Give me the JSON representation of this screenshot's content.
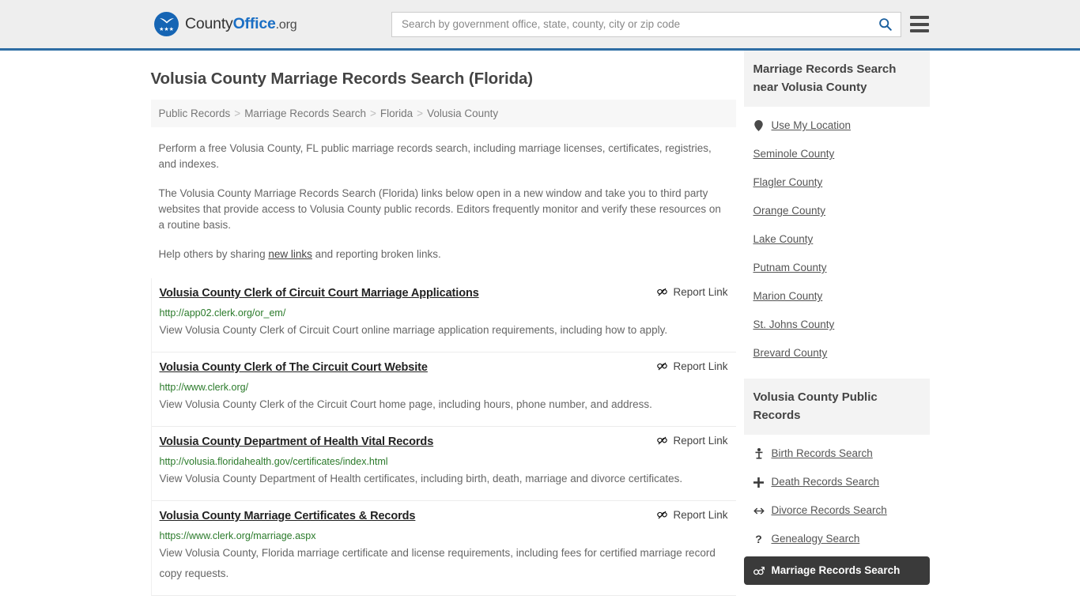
{
  "header": {
    "logo": {
      "text_county": "County",
      "text_office": "Office",
      "text_org": ".org",
      "stars": "★★★",
      "icon": "eagle-shield-logo"
    },
    "search": {
      "placeholder": "Search by government office, state, county, city or zip code",
      "value": "",
      "search_icon": "search-icon"
    },
    "menu_icon": "hamburger-menu-icon"
  },
  "page": {
    "title": "Volusia County Marriage Records Search (Florida)"
  },
  "breadcrumb": {
    "separator": ">",
    "items": [
      {
        "label": "Public Records"
      },
      {
        "label": "Marriage Records Search"
      },
      {
        "label": "Florida"
      },
      {
        "label": "Volusia County"
      }
    ]
  },
  "intro": {
    "paragraph1": "Perform a free Volusia County, FL public marriage records search, including marriage licenses, certificates, registries, and indexes.",
    "paragraph2": "The Volusia County Marriage Records Search (Florida) links below open in a new window and take you to third party websites that provide access to Volusia County public records. Editors frequently monitor and verify these resources on a routine basis.",
    "paragraph3_before": "Help others by sharing ",
    "paragraph3_link": "new links",
    "paragraph3_after": " and reporting broken links."
  },
  "report_link": {
    "label": "Report Link",
    "icon": "broken-link-icon"
  },
  "results": [
    {
      "title": "Volusia County Clerk of Circuit Court Marriage Applications",
      "url": "http://app02.clerk.org/or_em/",
      "description": "View Volusia County Clerk of Circuit Court online marriage application requirements, including how to apply."
    },
    {
      "title": "Volusia County Clerk of The Circuit Court Website",
      "url": "http://www.clerk.org/",
      "description": "View Volusia County Clerk of the Circuit Court home page, including hours, phone number, and address."
    },
    {
      "title": "Volusia County Department of Health Vital Records",
      "url": "http://volusia.floridahealth.gov/certificates/index.html",
      "description": "View Volusia County Department of Health certificates, including birth, death, marriage and divorce certificates."
    },
    {
      "title": "Volusia County Marriage Certificates & Records",
      "url": "https://www.clerk.org/marriage.aspx",
      "description": "View Volusia County, Florida marriage certificate and license requirements, including fees for certified marriage record copy requests."
    }
  ],
  "sidebar": {
    "nearby": {
      "heading": "Marriage Records Search near Volusia County",
      "items": [
        {
          "label": "Use My Location",
          "icon": "map-pin-icon",
          "has_icon": true
        },
        {
          "label": "Seminole County",
          "icon": "",
          "has_icon": false
        },
        {
          "label": "Flagler County",
          "icon": "",
          "has_icon": false
        },
        {
          "label": "Orange County",
          "icon": "",
          "has_icon": false
        },
        {
          "label": "Lake County",
          "icon": "",
          "has_icon": false
        },
        {
          "label": "Putnam County",
          "icon": "",
          "has_icon": false
        },
        {
          "label": "Marion County",
          "icon": "",
          "has_icon": false
        },
        {
          "label": "St. Johns County",
          "icon": "",
          "has_icon": false
        },
        {
          "label": "Brevard County",
          "icon": "",
          "has_icon": false
        }
      ]
    },
    "public_records": {
      "heading": "Volusia County Public Records",
      "items": [
        {
          "label": "Birth Records Search",
          "icon": "baby-icon",
          "glyph": "Ŧ",
          "active": false
        },
        {
          "label": "Death Records Search",
          "icon": "cross-icon",
          "glyph": "†",
          "active": false
        },
        {
          "label": "Divorce Records Search",
          "icon": "left-right-arrow-icon",
          "glyph": "↔",
          "active": false
        },
        {
          "label": "Genealogy Search",
          "icon": "question-mark-icon",
          "glyph": "?",
          "active": false
        },
        {
          "label": "Marriage Records Search",
          "icon": "venus-mars-icon",
          "glyph": "⚥",
          "active": true
        }
      ]
    }
  },
  "colors": {
    "header_bg": "#eeeeee",
    "header_border": "#2e6da4",
    "brand_blue": "#1b6fc4",
    "url_green": "#2a7a2a",
    "active_bg": "#3a3a3a",
    "panel_bg": "#f3f3f3"
  }
}
